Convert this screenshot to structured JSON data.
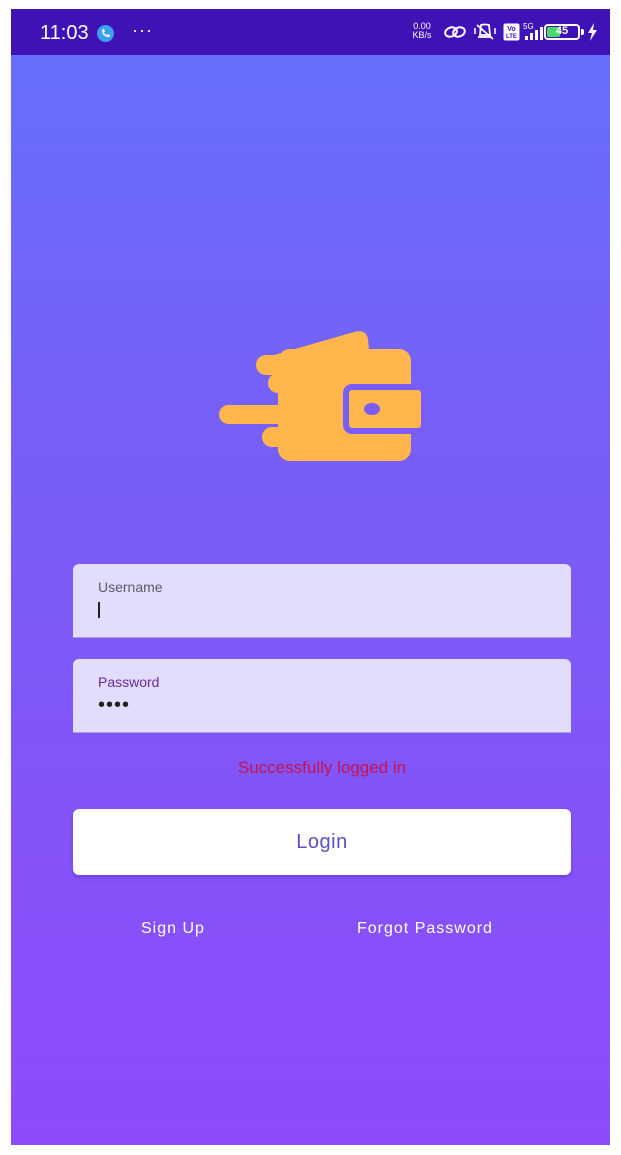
{
  "status_bar": {
    "time": "11:03",
    "net_speed_value": "0.00",
    "net_speed_unit": "KB/s",
    "network_type": "5G",
    "volte_badge": "Vo LTE",
    "battery_level": "45",
    "background_color": "#3f12b5",
    "icons": [
      "call-icon",
      "more-icon",
      "hotspot-link-icon",
      "vibrate-icon",
      "volte-icon",
      "signal-icon",
      "battery-icon",
      "charging-bolt-icon"
    ]
  },
  "logo": {
    "icon": "wallet-icon",
    "color": "#ffb74d"
  },
  "form": {
    "username": {
      "label": "Username",
      "value": ""
    },
    "password": {
      "label": "Password",
      "masked_value": "••••"
    },
    "message": "Successfully logged in",
    "message_color": "#c4134f",
    "login_button": "Login"
  },
  "links": {
    "sign_up": "Sign Up",
    "forgot_password": "Forgot Password"
  },
  "colors": {
    "gradient_top": "#6670fc",
    "gradient_bottom": "#8e4bfb",
    "field_background": "#e2dcfd",
    "button_text": "#5b4fc9"
  }
}
